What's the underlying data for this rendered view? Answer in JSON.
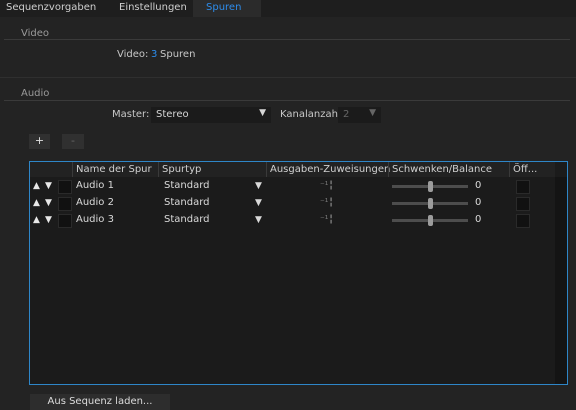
{
  "tabs": [
    {
      "label": "Sequenzvorgaben",
      "active": false
    },
    {
      "label": "Einstellungen",
      "active": false
    },
    {
      "label": "Spuren",
      "active": true
    }
  ],
  "video": {
    "section_label": "Video",
    "label": "Video:",
    "count": "3",
    "unit": "Spuren"
  },
  "audio": {
    "section_label": "Audio",
    "master_label": "Master:",
    "master_value": "Stereo",
    "channels_label": "Kanalanzahl:",
    "channels_value": "2",
    "add_label": "+",
    "remove_label": "-"
  },
  "table": {
    "headers": {
      "name": "Name der Spur",
      "type": "Spurtyp",
      "outputs": "Ausgaben-Zuweisungen",
      "pan": "Schwenken/Balance",
      "open": "Öff..."
    },
    "rows": [
      {
        "name": "Audio 1",
        "type": "Standard",
        "pan_value": "0"
      },
      {
        "name": "Audio 2",
        "type": "Standard",
        "pan_value": "0"
      },
      {
        "name": "Audio 3",
        "type": "Standard",
        "pan_value": "0"
      }
    ]
  },
  "footer": {
    "load_button": "Aus Sequenz laden..."
  },
  "colors": {
    "accent": "#2d8ceb",
    "background": "#232323",
    "table_border": "#2e86c8"
  }
}
